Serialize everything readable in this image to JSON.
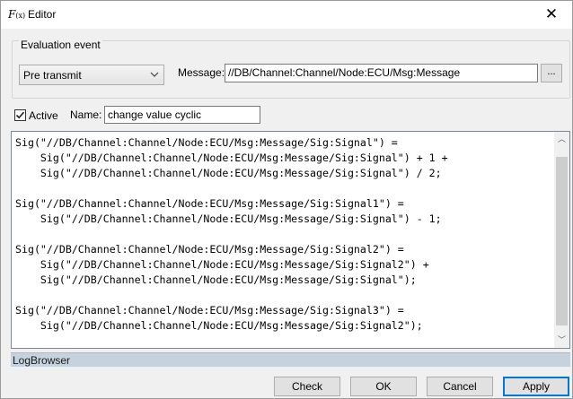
{
  "window": {
    "title": "Editor",
    "icon_text": "F",
    "icon_sub": "(x)",
    "close_glyph": "✕"
  },
  "evaluation": {
    "group_label": "Evaluation event",
    "event_value": "Pre transmit",
    "message_label": "Message:",
    "message_value": "//DB/Channel:Channel/Node:ECU/Msg:Message",
    "browse_label": "..."
  },
  "settings": {
    "active_label": "Active",
    "active_checked": true,
    "name_label": "Name:",
    "name_value": "change value cyclic"
  },
  "code_lines": [
    "Sig(\"//DB/Channel:Channel/Node:ECU/Msg:Message/Sig:Signal\") =",
    "    Sig(\"//DB/Channel:Channel/Node:ECU/Msg:Message/Sig:Signal\") + 1 +",
    "    Sig(\"//DB/Channel:Channel/Node:ECU/Msg:Message/Sig:Signal\") / 2;",
    "",
    "Sig(\"//DB/Channel:Channel/Node:ECU/Msg:Message/Sig:Signal1\") =",
    "    Sig(\"//DB/Channel:Channel/Node:ECU/Msg:Message/Sig:Signal\") - 1;",
    "",
    "Sig(\"//DB/Channel:Channel/Node:ECU/Msg:Message/Sig:Signal2\") =",
    "    Sig(\"//DB/Channel:Channel/Node:ECU/Msg:Message/Sig:Signal2\") +",
    "    Sig(\"//DB/Channel:Channel/Node:ECU/Msg:Message/Sig:Signal\");",
    "",
    "Sig(\"//DB/Channel:Channel/Node:ECU/Msg:Message/Sig:Signal3\") =",
    "    Sig(\"//DB/Channel:Channel/Node:ECU/Msg:Message/Sig:Signal2\");"
  ],
  "scrollbar": {
    "up_glyph": "︿",
    "down_glyph": "﹀"
  },
  "log": {
    "label": "LogBrowser"
  },
  "buttons": {
    "check": "Check",
    "ok": "OK",
    "cancel": "Cancel",
    "apply": "Apply"
  }
}
